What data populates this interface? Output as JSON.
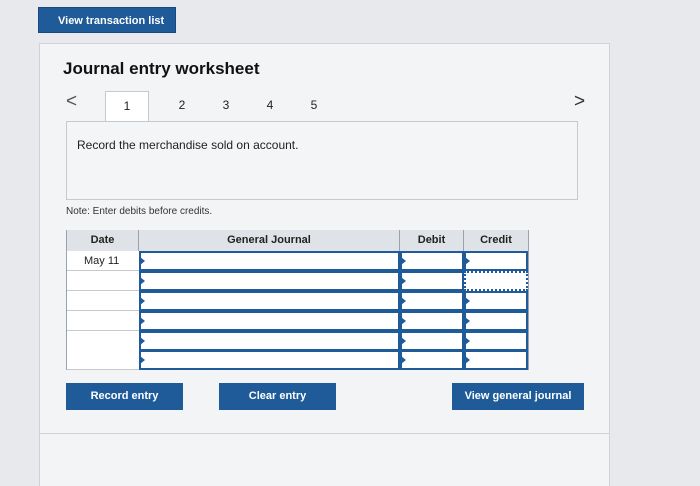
{
  "header": {
    "view_transactions_label": "View transaction list"
  },
  "worksheet": {
    "title": "Journal entry worksheet",
    "nav_prev": "<",
    "nav_next": ">",
    "tabs": [
      "1",
      "2",
      "3",
      "4",
      "5"
    ],
    "active_tab": "1",
    "prompt": "Record the merchandise sold on account.",
    "note": "Note: Enter debits before credits."
  },
  "journal": {
    "columns": [
      "Date",
      "General Journal",
      "Debit",
      "Credit"
    ],
    "rows": [
      {
        "date": "May 11",
        "account": "",
        "debit": "",
        "credit": ""
      },
      {
        "date": "",
        "account": "",
        "debit": "",
        "credit": ""
      },
      {
        "date": "",
        "account": "",
        "debit": "",
        "credit": ""
      },
      {
        "date": "",
        "account": "",
        "debit": "",
        "credit": ""
      },
      {
        "date": "",
        "account": "",
        "debit": "",
        "credit": ""
      },
      {
        "date": "",
        "account": "",
        "debit": "",
        "credit": ""
      }
    ]
  },
  "buttons": {
    "record": "Record entry",
    "clear": "Clear entry",
    "view_general_journal": "View general journal"
  },
  "colors": {
    "accent": "#1f5a99",
    "panel": "#f3f4f5"
  },
  "icons": {
    "prev": "chevron-left-icon",
    "next": "chevron-right-icon"
  }
}
